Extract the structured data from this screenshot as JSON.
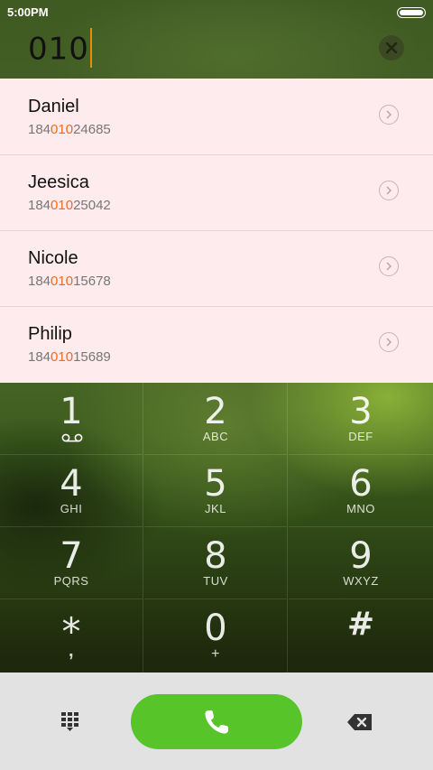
{
  "status_bar": {
    "time": "5:00PM"
  },
  "dial_input": {
    "value": "010"
  },
  "results": [
    {
      "name": "Daniel",
      "number_pre": "184",
      "number_match": "010",
      "number_post": "24685"
    },
    {
      "name": "Jeesica",
      "number_pre": "184",
      "number_match": "010",
      "number_post": "25042"
    },
    {
      "name": "Nicole",
      "number_pre": "184",
      "number_match": "010",
      "number_post": "15678"
    },
    {
      "name": "Philip",
      "number_pre": "184",
      "number_match": "010",
      "number_post": "15689"
    }
  ],
  "keys": [
    {
      "digit": "1",
      "letters": ""
    },
    {
      "digit": "2",
      "letters": "ABC"
    },
    {
      "digit": "3",
      "letters": "DEF"
    },
    {
      "digit": "4",
      "letters": "GHI"
    },
    {
      "digit": "5",
      "letters": "JKL"
    },
    {
      "digit": "6",
      "letters": "MNO"
    },
    {
      "digit": "7",
      "letters": "PQRS"
    },
    {
      "digit": "8",
      "letters": "TUV"
    },
    {
      "digit": "9",
      "letters": "WXYZ"
    },
    {
      "digit": "*",
      "letters": ","
    },
    {
      "digit": "0",
      "letters": "+"
    },
    {
      "digit": "#",
      "letters": ""
    }
  ],
  "icons": {
    "clear": "close-circle-icon",
    "detail": "chevron-right-circle-icon",
    "voicemail": "voicemail-icon",
    "dialpad": "dialpad-icon",
    "call": "phone-icon",
    "backspace": "backspace-icon"
  },
  "colors": {
    "highlight": "#f06a1a",
    "call_button": "#57c42a",
    "results_bg": "#fdebee",
    "caret": "#f08a00"
  }
}
